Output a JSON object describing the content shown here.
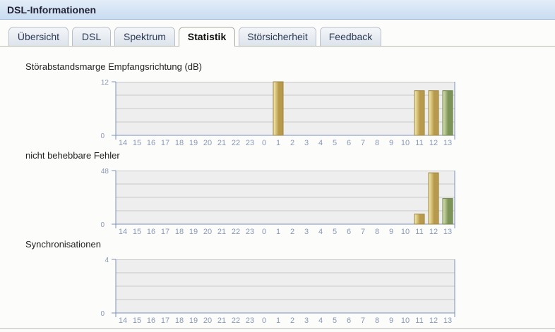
{
  "window": {
    "title": "DSL-Informationen"
  },
  "tabs": [
    {
      "label": "Übersicht",
      "active": false
    },
    {
      "label": "DSL",
      "active": false
    },
    {
      "label": "Spektrum",
      "active": false
    },
    {
      "label": "Statistik",
      "active": true
    },
    {
      "label": "Störsicherheit",
      "active": false
    },
    {
      "label": "Feedback",
      "active": false
    }
  ],
  "colors": {
    "plot_bg": "#eeeeee",
    "grid": "#c8c8c8",
    "axis": "#7a92bd",
    "tick_label": "#8898b8",
    "bar_yellow_light": "#f6eeb0",
    "bar_yellow_dark": "#b89a4c",
    "bar_green_light": "#e0e8b8",
    "bar_green_dark": "#7d9458"
  },
  "chart_data": [
    {
      "type": "bar",
      "title": "Störabstandsmarge Empfangsrichtung (dB)",
      "categories": [
        "14",
        "15",
        "16",
        "17",
        "18",
        "19",
        "20",
        "21",
        "22",
        "23",
        "0",
        "1",
        "2",
        "3",
        "4",
        "5",
        "6",
        "7",
        "8",
        "9",
        "10",
        "11",
        "12",
        "13"
      ],
      "values": [
        0,
        0,
        0,
        0,
        0,
        0,
        0,
        0,
        0,
        0,
        0,
        12,
        0,
        0,
        0,
        0,
        0,
        0,
        0,
        0,
        0,
        10,
        10,
        10
      ],
      "highlight_last": true,
      "ylim": [
        0,
        12
      ],
      "yticks": [
        "0",
        "12"
      ],
      "grid": true
    },
    {
      "type": "bar",
      "title": "nicht behebbare Fehler",
      "categories": [
        "14",
        "15",
        "16",
        "17",
        "18",
        "19",
        "20",
        "21",
        "22",
        "23",
        "0",
        "1",
        "2",
        "3",
        "4",
        "5",
        "6",
        "7",
        "8",
        "9",
        "10",
        "11",
        "12",
        "13"
      ],
      "values": [
        0,
        0,
        0,
        0,
        0,
        0,
        0,
        0,
        0,
        0,
        0,
        0,
        0,
        0,
        0,
        0,
        0,
        0,
        0,
        0,
        0,
        9,
        46,
        23
      ],
      "highlight_last": true,
      "ylim": [
        0,
        48
      ],
      "yticks": [
        "0",
        "48"
      ],
      "grid": true
    },
    {
      "type": "bar",
      "title": "Synchronisationen",
      "categories": [
        "14",
        "15",
        "16",
        "17",
        "18",
        "19",
        "20",
        "21",
        "22",
        "23",
        "0",
        "1",
        "2",
        "3",
        "4",
        "5",
        "6",
        "7",
        "8",
        "9",
        "10",
        "11",
        "12",
        "13"
      ],
      "values": [
        0,
        0,
        0,
        0,
        0,
        0,
        0,
        0,
        0,
        0,
        0,
        0,
        0,
        0,
        0,
        0,
        0,
        0,
        0,
        0,
        0,
        0,
        0,
        0
      ],
      "highlight_last": true,
      "ylim": [
        0,
        4
      ],
      "yticks": [
        "0",
        "4"
      ],
      "grid": true
    }
  ]
}
